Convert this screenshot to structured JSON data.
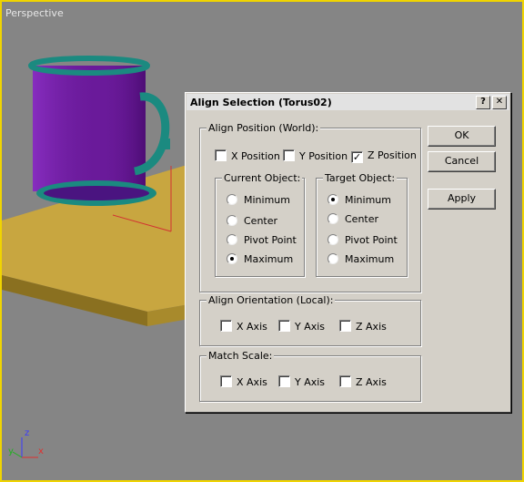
{
  "viewport": {
    "label": "Perspective"
  },
  "dialog": {
    "title": "Align Selection (Torus02)",
    "help_glyph": "?",
    "close_glyph": "✕",
    "align_position": {
      "legend": "Align Position (World):",
      "x_label": "X Position",
      "x_checked": false,
      "y_label": "Y Position",
      "y_checked": false,
      "z_label": "Z Position",
      "z_checked": true,
      "current": {
        "legend": "Current Object:",
        "options": [
          "Minimum",
          "Center",
          "Pivot Point",
          "Maximum"
        ],
        "selected": "Maximum"
      },
      "target": {
        "legend": "Target Object:",
        "options": [
          "Minimum",
          "Center",
          "Pivot Point",
          "Maximum"
        ],
        "selected": "Minimum"
      }
    },
    "align_orientation": {
      "legend": "Align Orientation (Local):",
      "x_label": "X Axis",
      "y_label": "Y Axis",
      "z_label": "Z Axis"
    },
    "match_scale": {
      "legend": "Match Scale:",
      "x_label": "X Axis",
      "y_label": "Y Axis",
      "z_label": "Z Axis"
    },
    "buttons": {
      "ok": "OK",
      "cancel": "Cancel",
      "apply": "Apply"
    }
  },
  "axis_gizmo": {
    "x": "x",
    "y": "y",
    "z": "z"
  }
}
